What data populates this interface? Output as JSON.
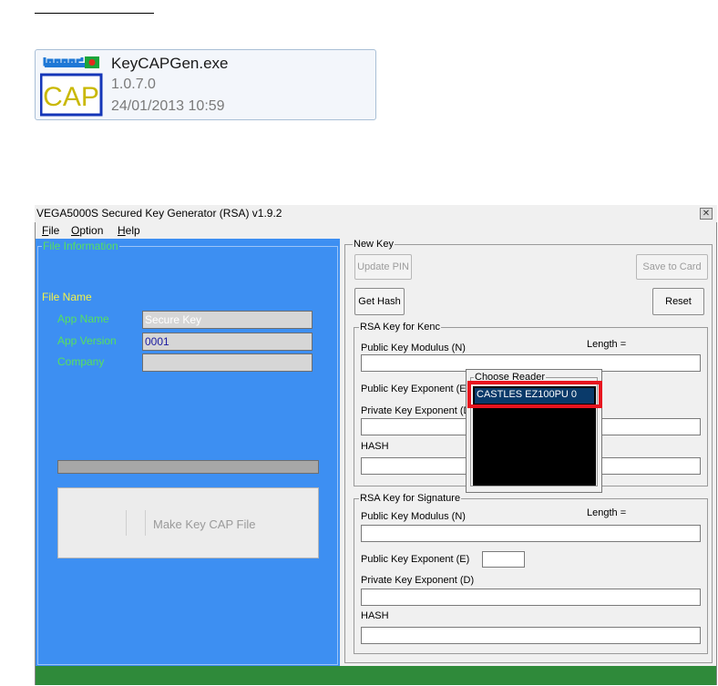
{
  "file": {
    "name": "KeyCAPGen.exe",
    "version": "1.0.7.0",
    "date": "24/01/2013 10:59",
    "icon_text": "CAP"
  },
  "window": {
    "title": "VEGA5000S Secured Key Generator (RSA) v1.9.2",
    "close_glyph": "✕",
    "menu": [
      {
        "accel": "F",
        "rest": "ile"
      },
      {
        "accel": "O",
        "rest": "ption"
      },
      {
        "accel": "H",
        "rest": "elp"
      }
    ]
  },
  "left": {
    "group_title": "File Information",
    "file_name_label": "File Name",
    "app_name_label": "App Name",
    "app_name_value": "Secure Key",
    "app_version_label": "App Version",
    "app_version_value": "0001",
    "company_label": "Company",
    "company_value": "",
    "make_button": "Make Key CAP File"
  },
  "right": {
    "newkey_title": "New Key",
    "update_pin": "Update PIN",
    "save_to_card": "Save to Card",
    "get_hash": "Get Hash",
    "reset": "Reset",
    "kenc": {
      "title": "RSA Key for Kenc",
      "modulus_label": "Public Key Modulus (N)",
      "length_label": "Length =",
      "exponent_label": "Public Key Exponent (E)",
      "private_label": "Private Key Exponent (D)",
      "hash_label": "HASH"
    },
    "sig": {
      "title": "RSA Key for Signature",
      "modulus_label": "Public Key Modulus (N)",
      "length_label": "Length =",
      "exponent_label": "Public Key Exponent (E)",
      "private_label": "Private Key Exponent (D)",
      "hash_label": "HASH"
    }
  },
  "popup": {
    "title": "Choose Reader",
    "readers": [
      "CASTLES EZ100PU 0"
    ]
  },
  "colors": {
    "panel_blue": "#3d8ff2",
    "label_green": "#56e05f",
    "label_yellow": "#f2f24a",
    "status_green": "#2f8a3a",
    "highlight_red": "#e8141e"
  }
}
